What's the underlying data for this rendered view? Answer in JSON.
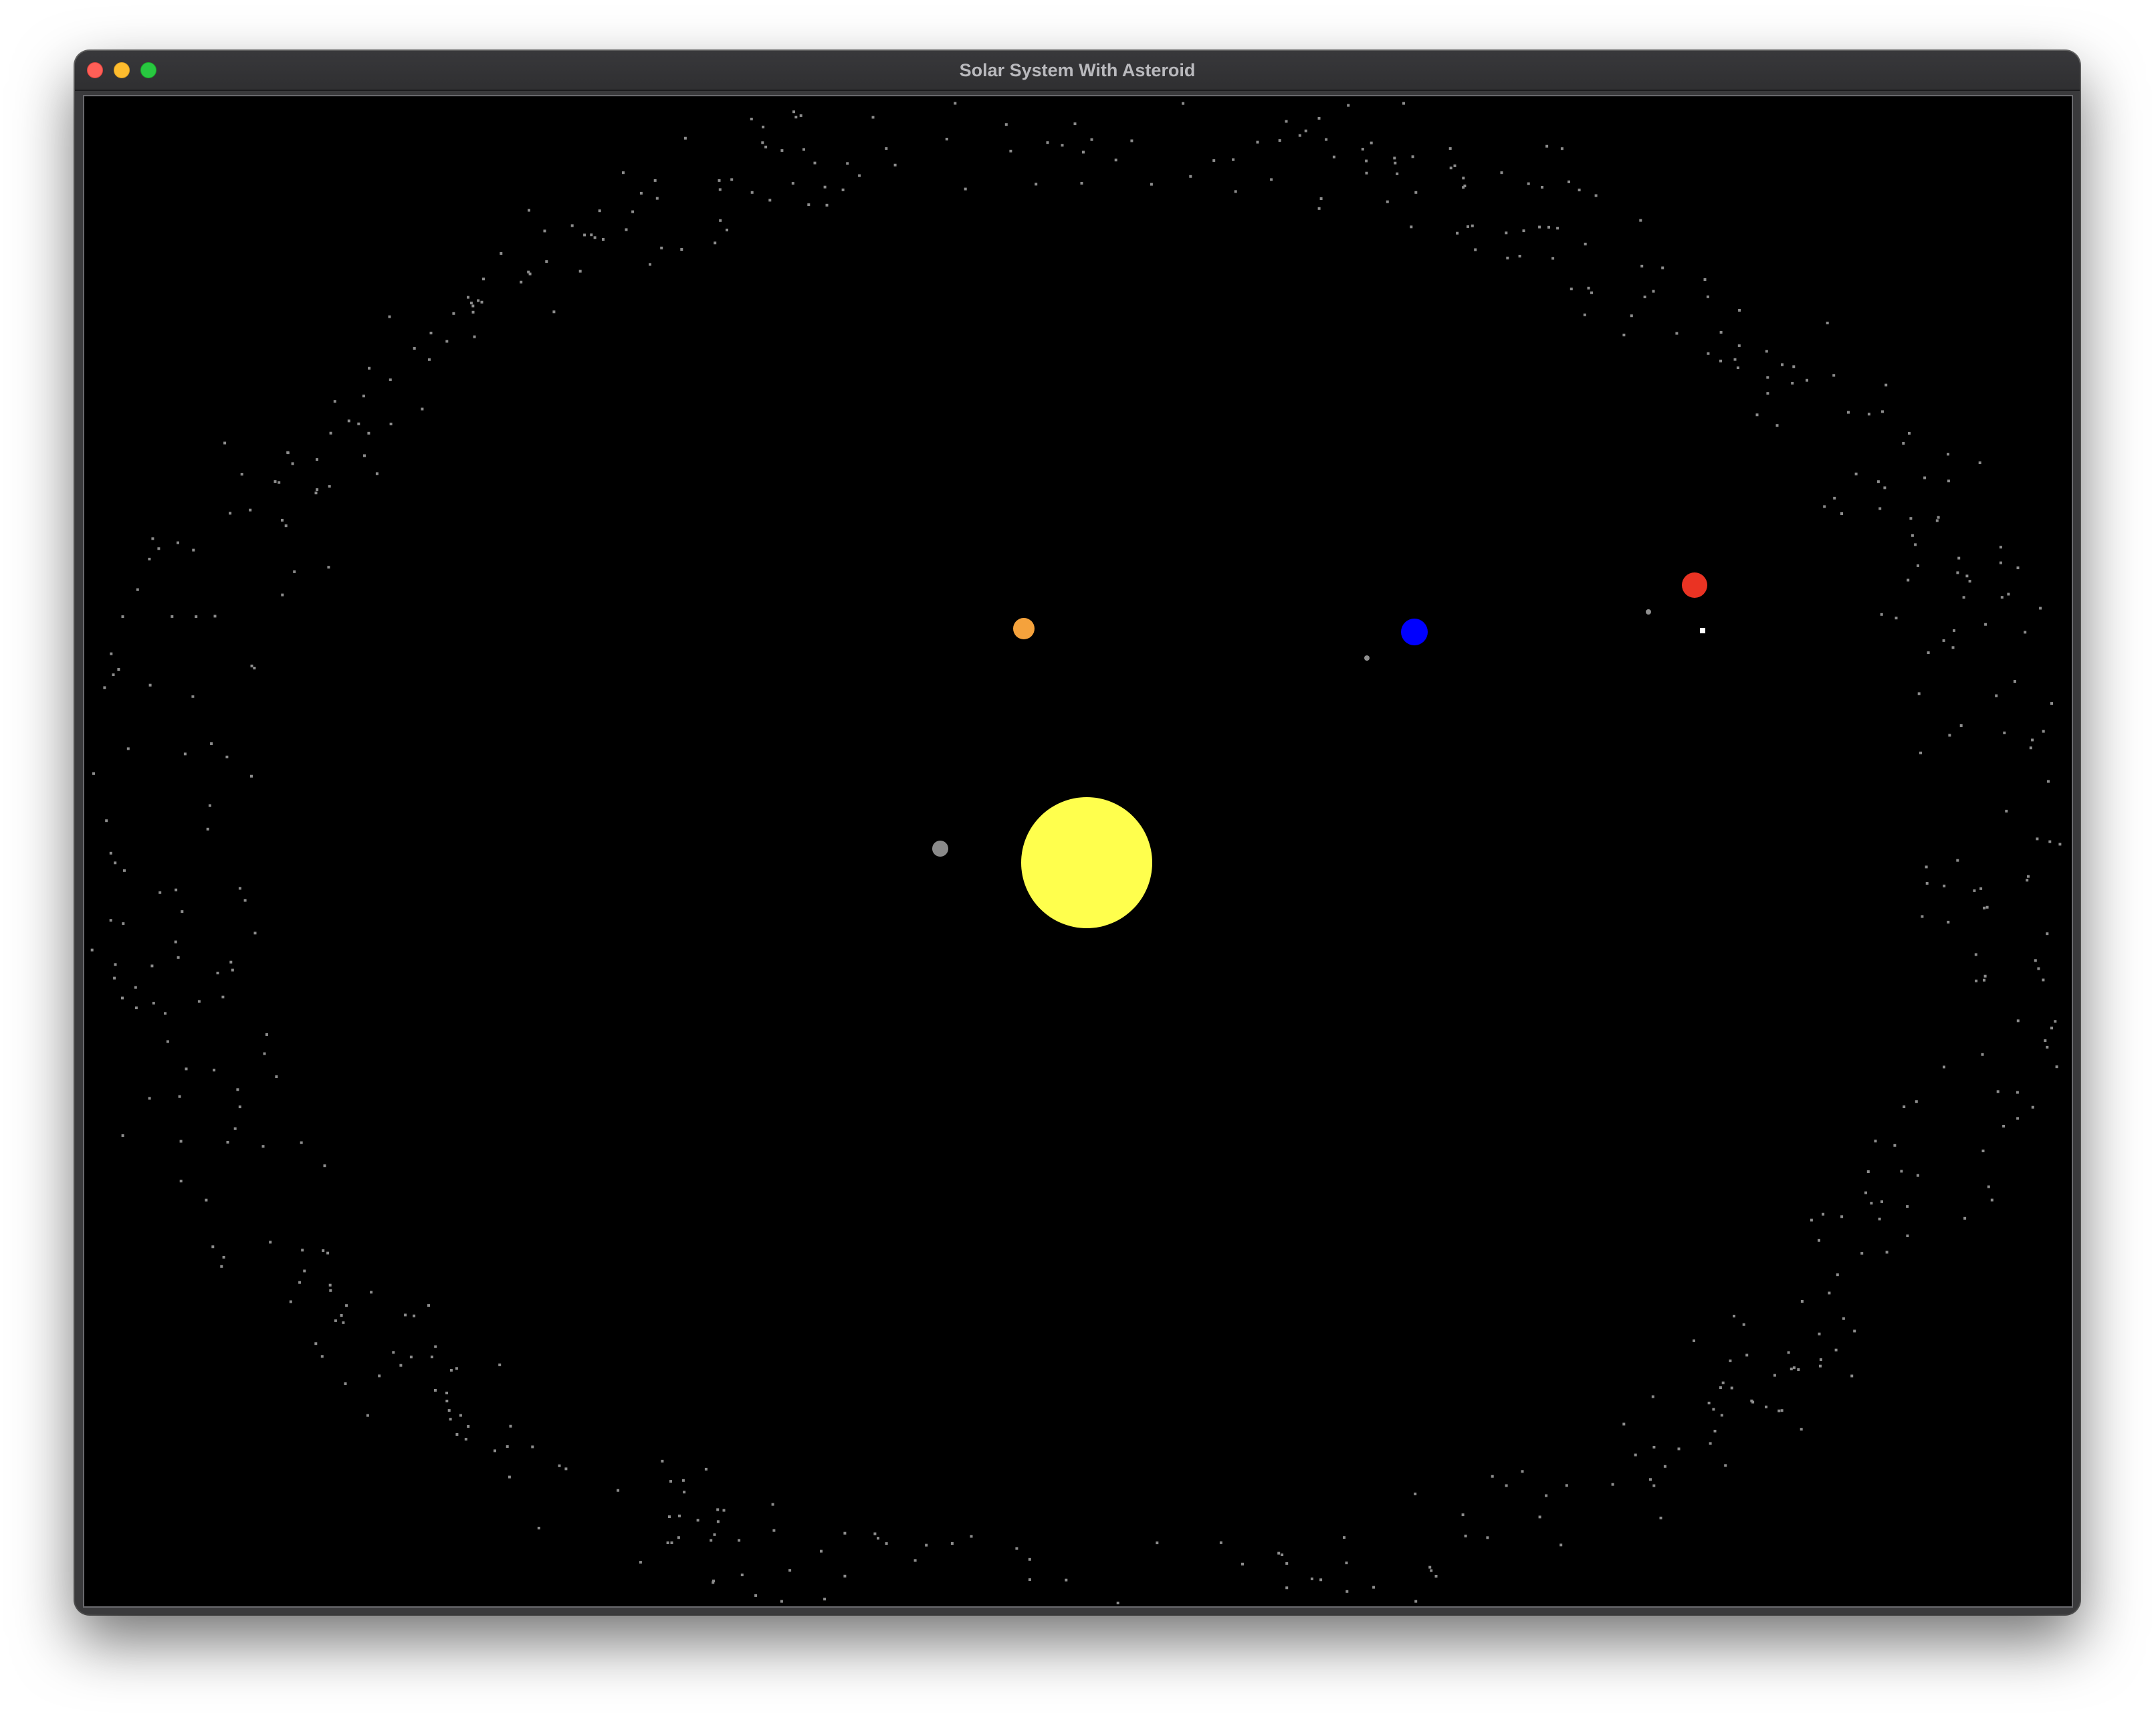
{
  "window": {
    "title": "Solar System With Asteroid"
  },
  "colors": {
    "sun": "#ffff4d",
    "planet_gray": "#8a8a8a",
    "planet_orange": "#f5a23c",
    "planet_blue": "#0000ff",
    "planet_red": "#ea3323",
    "moon_gray": "#8f8f8f",
    "asteroid_white": "#ffffff",
    "belt_particle": "#8c8c8c",
    "background": "#000000"
  },
  "bodies": [
    {
      "name": "sun",
      "kind": "star"
    },
    {
      "name": "gray-planet",
      "kind": "planet"
    },
    {
      "name": "orange-planet",
      "kind": "planet"
    },
    {
      "name": "blue-planet",
      "kind": "planet"
    },
    {
      "name": "blue-planet-moon",
      "kind": "moon"
    },
    {
      "name": "red-planet",
      "kind": "planet"
    },
    {
      "name": "red-planet-moon",
      "kind": "moon"
    },
    {
      "name": "asteroid",
      "kind": "asteroid"
    }
  ]
}
